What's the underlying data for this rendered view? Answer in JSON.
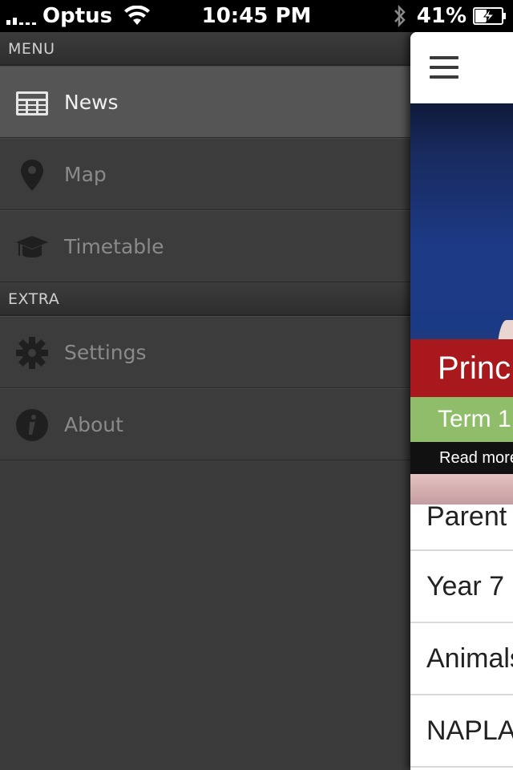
{
  "status_bar": {
    "carrier": "Optus",
    "time": "10:45 PM",
    "battery": "41%"
  },
  "menu": {
    "sections": [
      {
        "title": "MENU",
        "items": [
          {
            "label": "News",
            "icon": "newspaper-icon",
            "active": true
          },
          {
            "label": "Map",
            "icon": "map-pin-icon",
            "active": false
          },
          {
            "label": "Timetable",
            "icon": "graduation-cap-icon",
            "active": false
          }
        ]
      },
      {
        "title": "EXTRA",
        "items": [
          {
            "label": "Settings",
            "icon": "gear-icon",
            "active": false
          },
          {
            "label": "About",
            "icon": "info-icon",
            "active": false
          }
        ]
      }
    ]
  },
  "content": {
    "banner": {
      "title": "Princ",
      "subtitle": "Term 1",
      "read_more": "Read more"
    },
    "news_items": [
      "Parent",
      "Year 7",
      "Animals",
      "NAPLA"
    ]
  },
  "colors": {
    "banner_red": "#a8181c",
    "banner_green": "#8fbd6a",
    "menu_bg": "#3b3b3b",
    "active_item_bg": "#555555"
  }
}
